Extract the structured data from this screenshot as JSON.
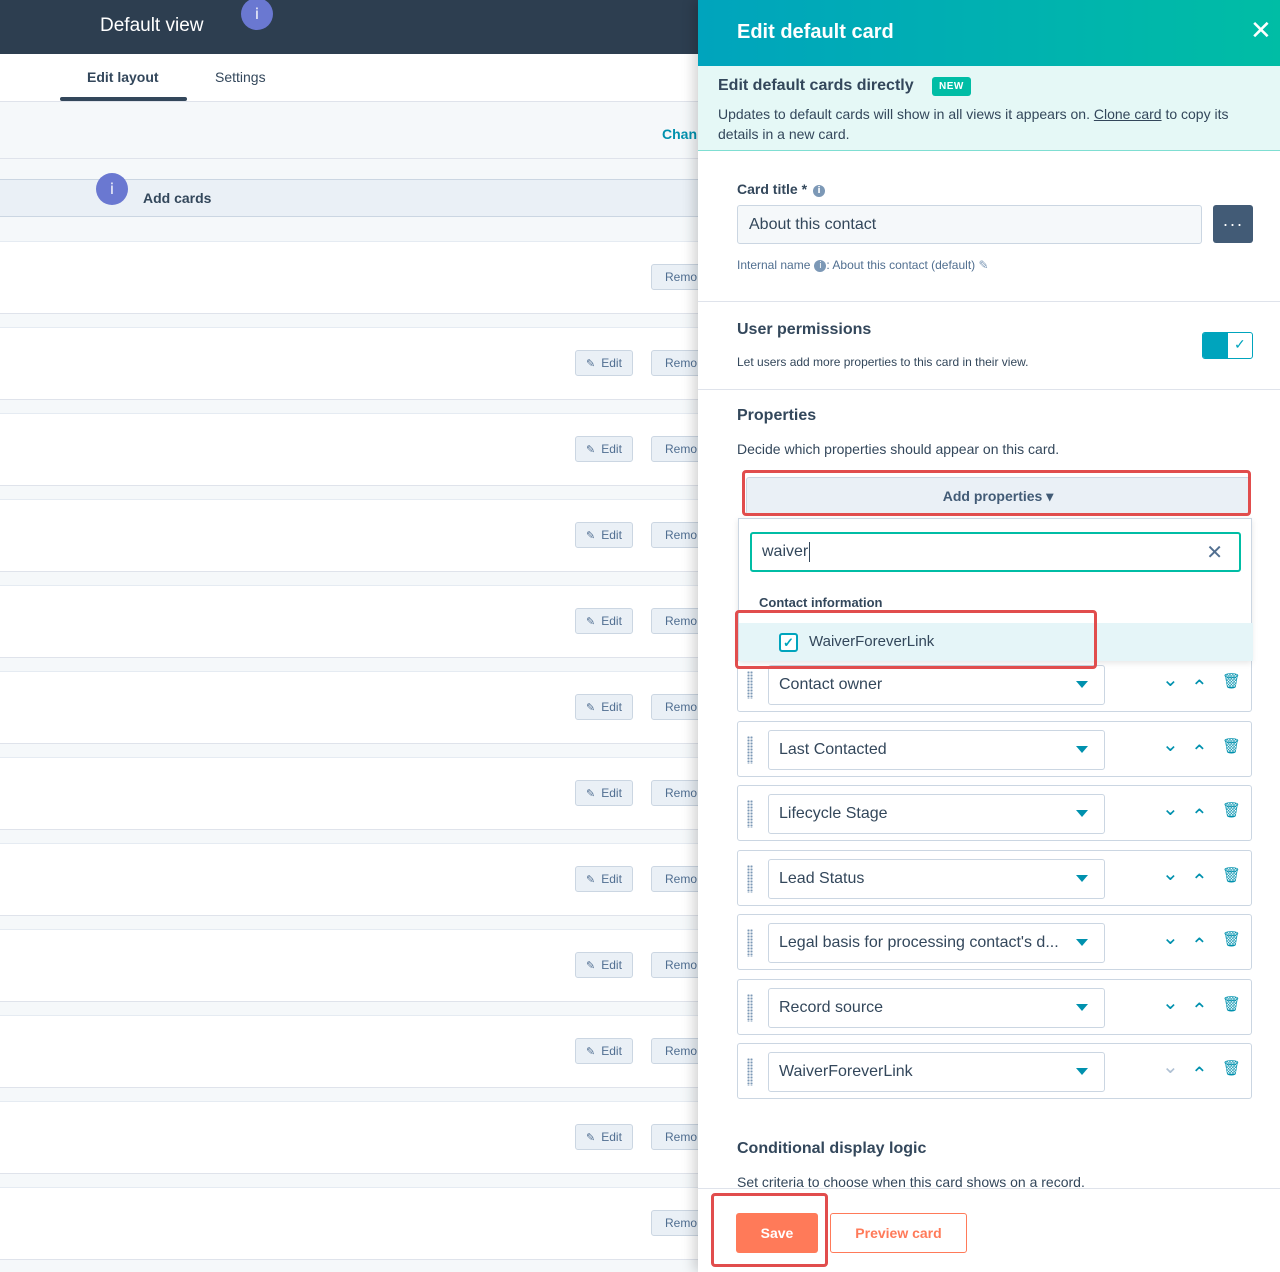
{
  "left": {
    "title": "Default view",
    "info_glyph": "i",
    "tabs": [
      {
        "label": "Edit layout",
        "active": true
      },
      {
        "label": "Settings",
        "active": false
      }
    ],
    "change_link": "Chan",
    "add_cards_label": "Add cards",
    "edit_label": "Edit",
    "remove_label": "Remo",
    "edit_icon": "pencil-icon"
  },
  "panel": {
    "title": "Edit default card",
    "close_glyph": "✕",
    "banner": {
      "title": "Edit default cards directly",
      "badge": "NEW",
      "text_before": "Updates to default cards will show in all views it appears on. ",
      "link": "Clone card",
      "text_after": " to copy its details in a new card."
    },
    "card_title": {
      "label": "Card title *",
      "value": "About this contact",
      "more_glyph": "···",
      "internal_name_label": "Internal name",
      "internal_name_value": ": About this contact (default)",
      "edit_icon": "pencil-icon"
    },
    "permissions": {
      "title": "User permissions",
      "description": "Let users add more properties to this card in their view.",
      "enabled": true
    },
    "properties": {
      "title": "Properties",
      "description": "Decide which properties should appear on this card.",
      "add_button": "Add properties ▾",
      "search_value": "waiver",
      "group_label": "Contact information",
      "option_label": "WaiverForeverLink",
      "option_checked": true,
      "list": [
        {
          "label": "Contact owner",
          "down_disabled": false
        },
        {
          "label": "Last Contacted",
          "down_disabled": false
        },
        {
          "label": "Lifecycle Stage",
          "down_disabled": false
        },
        {
          "label": "Lead Status",
          "down_disabled": false
        },
        {
          "label": "Legal basis for processing contact's d...",
          "down_disabled": false
        },
        {
          "label": "Record source",
          "down_disabled": false
        },
        {
          "label": "WaiverForeverLink",
          "down_disabled": true
        }
      ]
    },
    "conditional": {
      "title": "Conditional display logic",
      "description": "Set criteria to choose when this card shows on a record."
    },
    "footer": {
      "save": "Save",
      "preview": "Preview card"
    }
  },
  "colors": {
    "accent": "#00a4bd",
    "save": "#ff7a59",
    "highlight": "#e14d4d",
    "dark_header": "#2d3e50"
  }
}
